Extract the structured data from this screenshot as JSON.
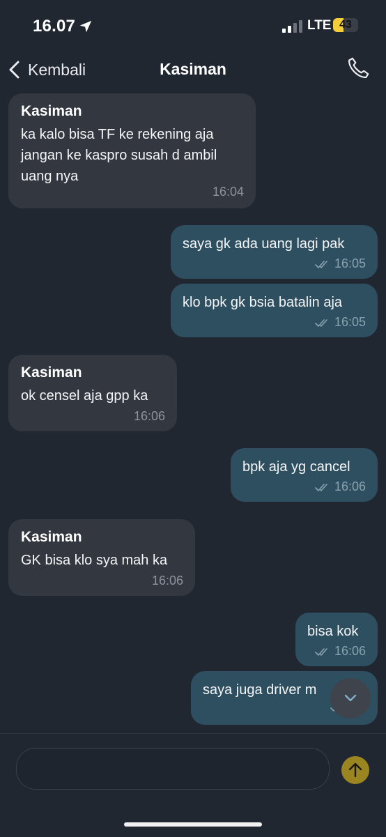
{
  "status_bar": {
    "time": "16.07",
    "network": "LTE",
    "battery": "43",
    "battery_level": 0.43
  },
  "header": {
    "back_label": "Kembali",
    "title": "Kasiman"
  },
  "messages": [
    {
      "direction": "in",
      "sender": "Kasiman",
      "text": "ka kalo bisa TF ke rekening aja\njangan ke kaspro susah d ambil\nuang nya",
      "time": "16:04"
    },
    {
      "direction": "out",
      "text": "saya gk ada uang lagi pak",
      "time": "16:05"
    },
    {
      "direction": "out",
      "text": "klo bpk gk bsia batalin aja",
      "time": "16:05"
    },
    {
      "direction": "in",
      "sender": "Kasiman",
      "text": "ok censel aja gpp ka",
      "time": "16:06"
    },
    {
      "direction": "out",
      "text": "bpk aja yg cancel",
      "time": "16:06"
    },
    {
      "direction": "in",
      "sender": "Kasiman",
      "text": "GK bisa klo sya mah ka",
      "time": "16:06"
    },
    {
      "direction": "out",
      "text": "bisa kok",
      "time": "16:06"
    },
    {
      "direction": "out",
      "text": "saya juga driver m",
      "time": ""
    }
  ],
  "composer": {
    "value": "",
    "placeholder": ""
  },
  "icons": {
    "back": "chevron-left-icon",
    "call": "phone-icon",
    "read": "double-check-icon",
    "scroll": "chevron-down-icon",
    "send": "arrow-up-icon",
    "location": "location-arrow-icon"
  },
  "colors": {
    "background": "#212731",
    "incoming_bubble": "#333840",
    "outgoing_bubble": "#2e4f60",
    "send_button": "#9b8520",
    "battery": "#f4cd3a"
  }
}
